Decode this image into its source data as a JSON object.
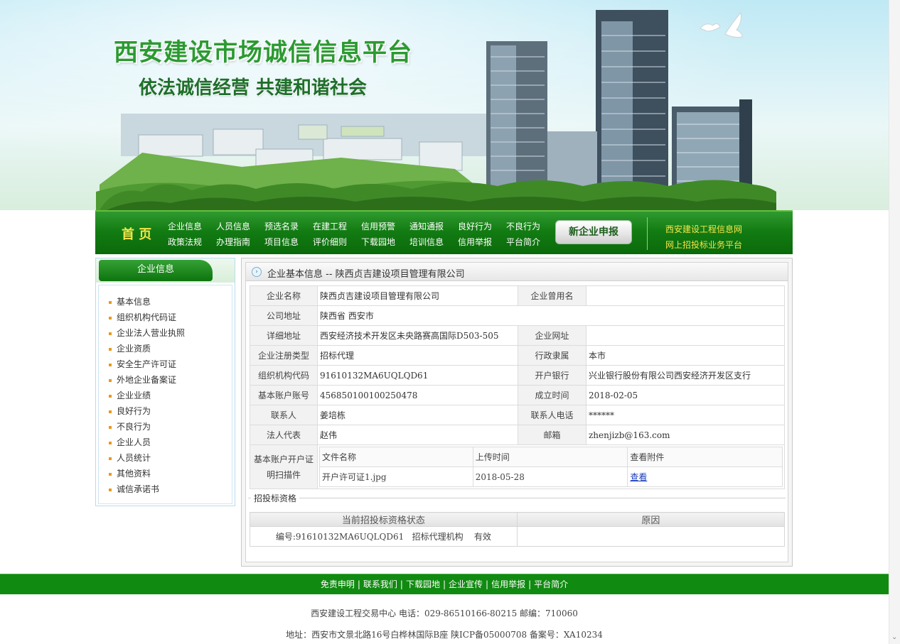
{
  "banner": {
    "title": "西安建设市场诚信信息平台",
    "slogan": "依法诚信经营  共建和谐社会"
  },
  "nav": {
    "home": "首 页",
    "row1": [
      "企业信息",
      "人员信息",
      "预选名录",
      "在建工程",
      "信用预警",
      "通知通报",
      "良好行为",
      "不良行为"
    ],
    "row2": [
      "政策法规",
      "办理指南",
      "项目信息",
      "评价细则",
      "下载园地",
      "培训信息",
      "信用举报",
      "平台简介"
    ],
    "new_company_button": "新企业申报",
    "external": [
      "西安建设工程信息网",
      "网上招投标业务平台"
    ]
  },
  "sidebar": {
    "title": "企业信息",
    "items": [
      "基本信息",
      "组织机构代码证",
      "企业法人营业执照",
      "企业资质",
      "安全生产许可证",
      "外地企业备案证",
      "企业业绩",
      "良好行为",
      "不良行为",
      "企业人员",
      "人员统计",
      "其他资料",
      "诚信承诺书"
    ]
  },
  "main": {
    "title": "企业基本信息  -- 陕西贞吉建设项目管理有限公司",
    "rows": [
      {
        "l1": "企业名称",
        "v1": "陕西贞吉建设项目管理有限公司",
        "l2": "企业曾用名",
        "v2": ""
      },
      {
        "l1": "公司地址",
        "v1": "陕西省  西安市"
      },
      {
        "l1": "详细地址",
        "v1": "西安经济技术开发区未央路赛高国际D503-505",
        "l2": "企业网址",
        "v2": ""
      },
      {
        "l1": "企业注册类型",
        "v1": "招标代理",
        "l2": "行政隶属",
        "v2": "本市"
      },
      {
        "l1": "组织机构代码",
        "v1": "91610132MA6UQLQD61",
        "l2": "开户银行",
        "v2": "兴业银行股份有限公司西安经济开发区支行"
      },
      {
        "l1": "基本账户账号",
        "v1": "456850100100250478",
        "l2": "成立时间",
        "v2": "2018-02-05"
      },
      {
        "l1": "联系人",
        "v1": "姜培栋",
        "l2": "联系人电话",
        "v2": "******"
      },
      {
        "l1": "法人代表",
        "v1": "赵伟",
        "l2": "邮箱",
        "v2": "zhenjizb@163.com"
      }
    ],
    "attachment_label_line1": "基本账户开户证",
    "attachment_label_line2": "明扫描件",
    "attachments": {
      "headers": [
        "文件名称",
        "上传时间",
        "查看附件"
      ],
      "rows": [
        {
          "name": "开户许可证1.jpg",
          "date": "2018-05-28",
          "link": "查看"
        }
      ]
    },
    "bid_section": {
      "legend": "招投标资格",
      "headers": [
        "当前招投标资格状态",
        "原因"
      ],
      "status": "编号:91610132MA6UQLQD61   招标代理机构    有效",
      "reason": ""
    }
  },
  "footer": {
    "links": [
      "免责申明",
      "联系我们",
      "下载园地",
      "企业宣传",
      "信用举报",
      "平台简介"
    ],
    "line1": "西安建设工程交易中心  电话：029-86510166-80215 邮编：710060",
    "line2": "地址：西安市文景北路16号白桦林国际B座  陕ICP备05000708 备案号：XA10234"
  },
  "colors": {
    "nav_green": "#137c13",
    "accent_yellow": "#f7e64a",
    "footer_green": "#118a11",
    "link_blue": "#1a3dbb"
  }
}
